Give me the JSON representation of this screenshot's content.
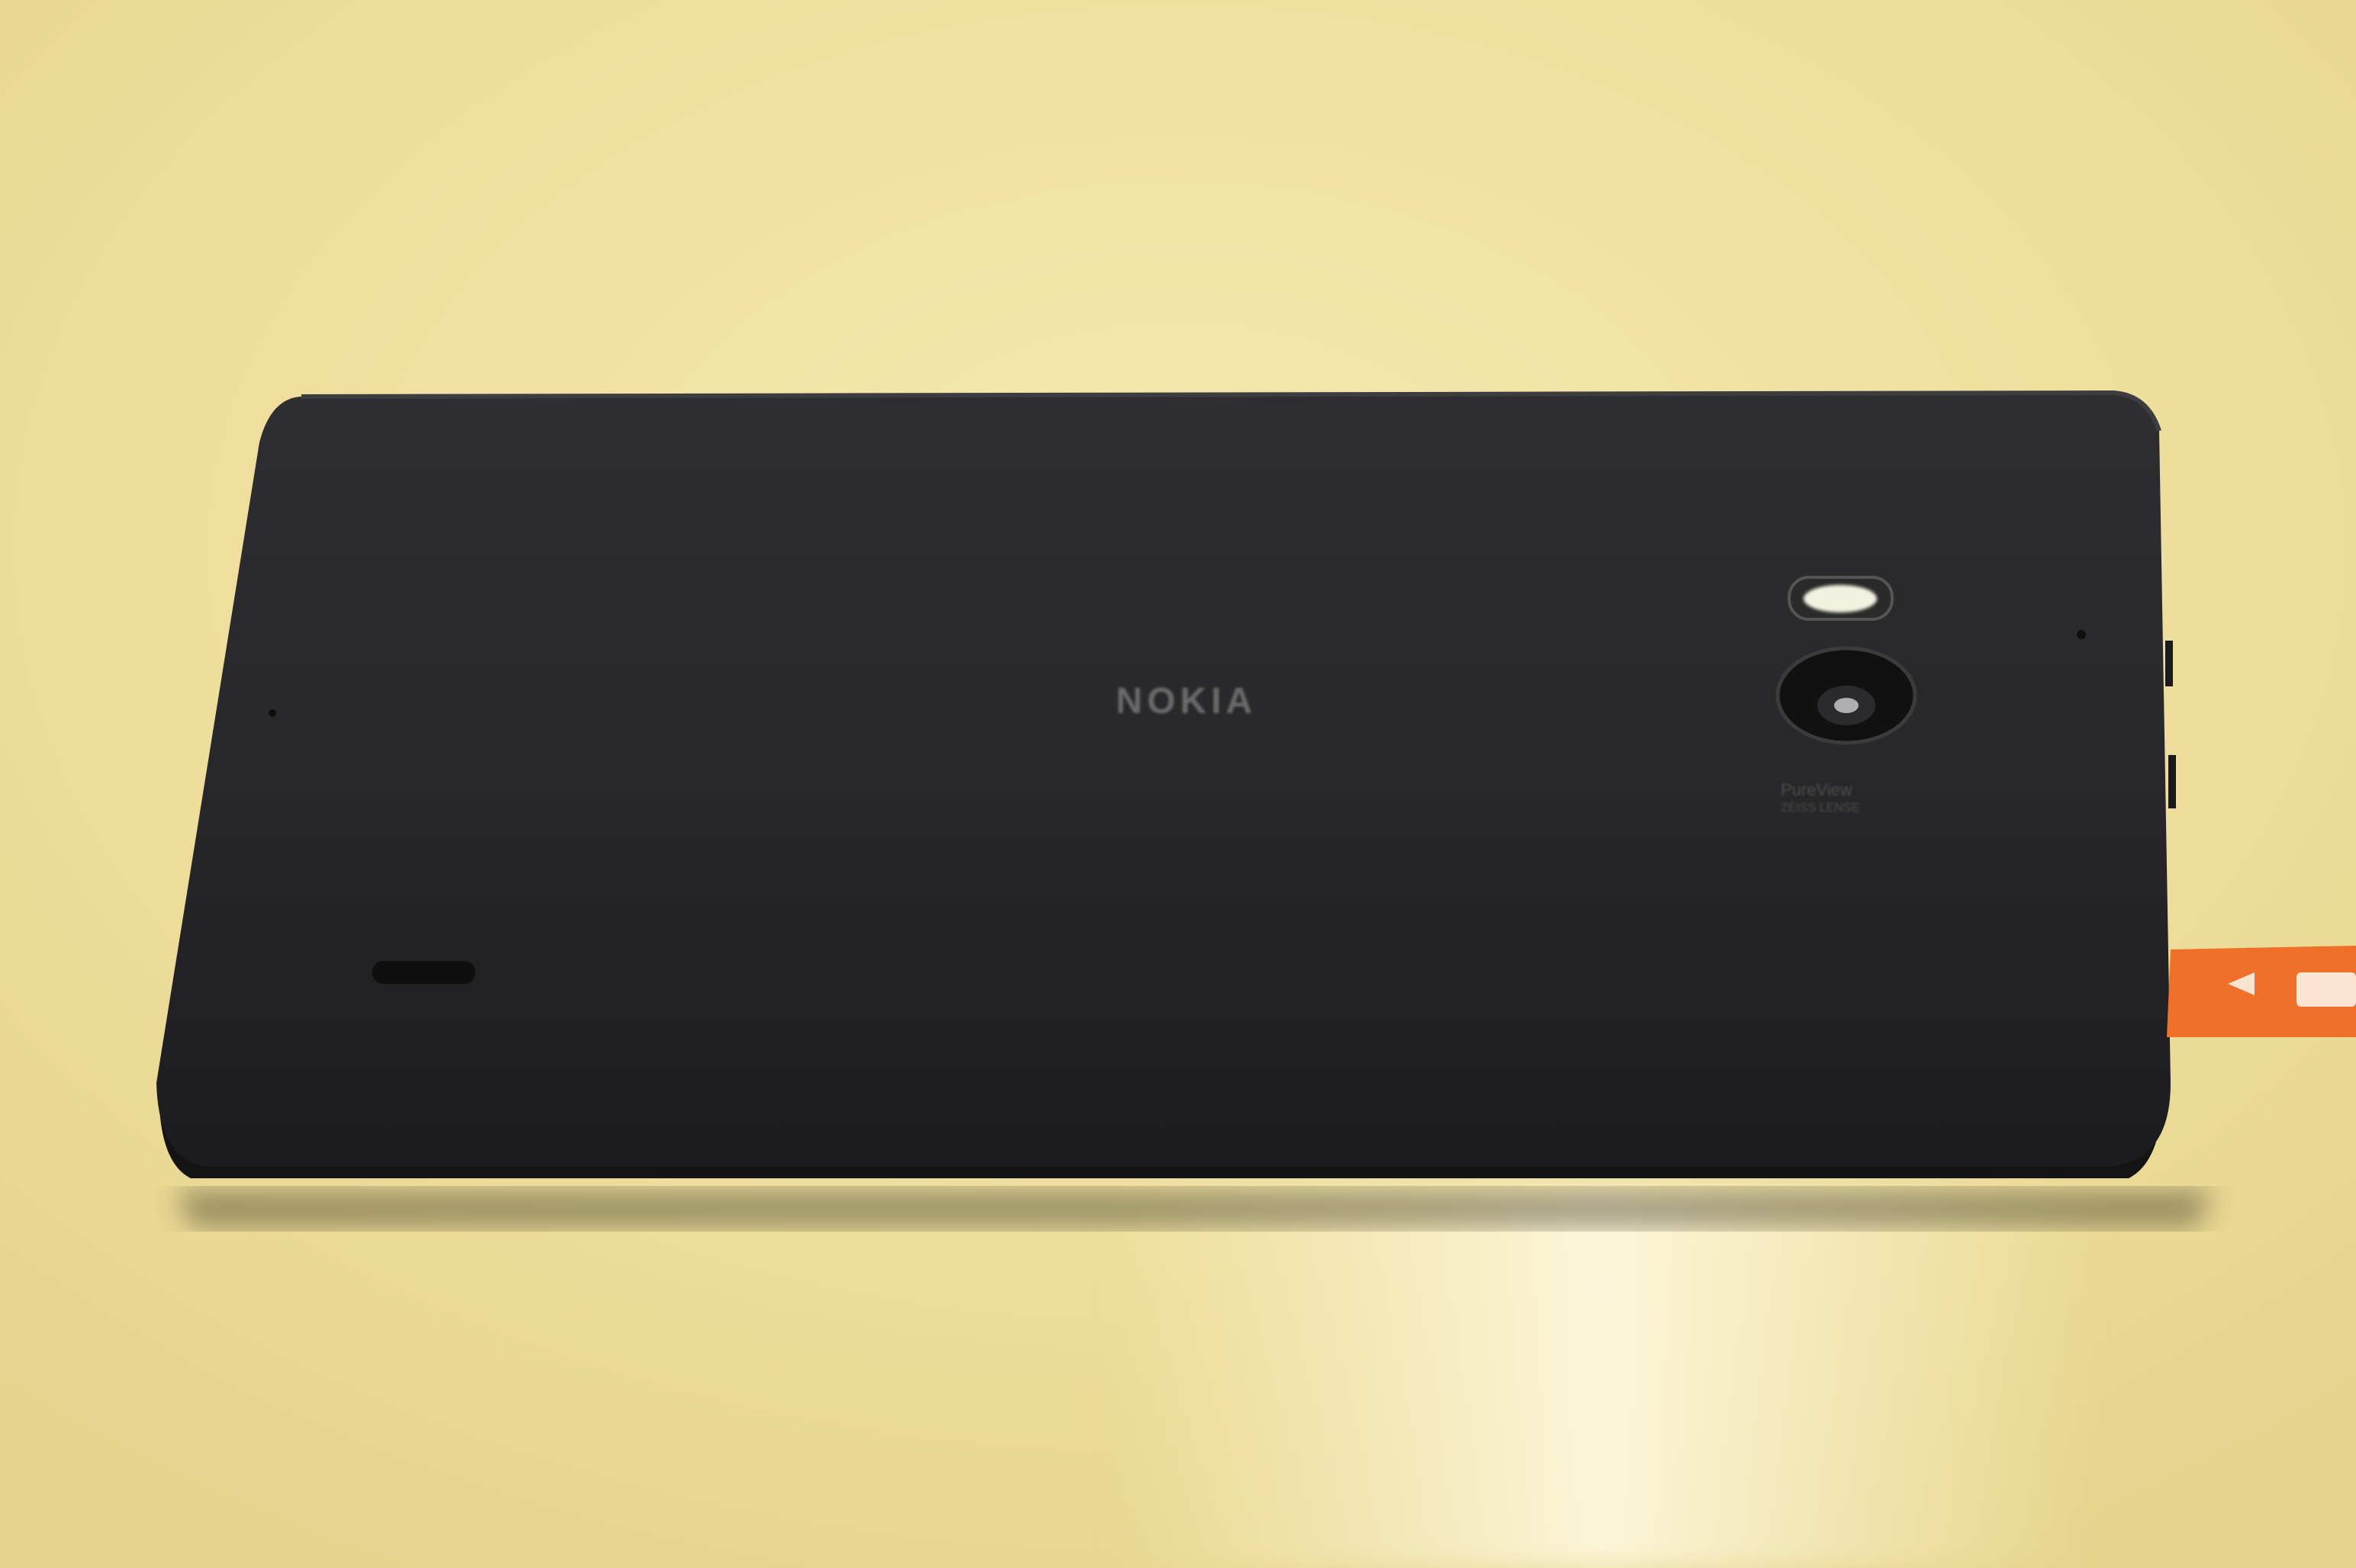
{
  "scene": {
    "description_tag": "photo",
    "colors": {
      "tabletop": "#efe1a4",
      "phone_body": "#28282a",
      "phone_edge": "#141415",
      "logo": "#6a6a6c",
      "strap": "#f0702a"
    }
  },
  "phone": {
    "brand": "NOKIA",
    "camera_badge_line1": "PureView",
    "camera_badge_line2": "ZEISS LENSE"
  }
}
